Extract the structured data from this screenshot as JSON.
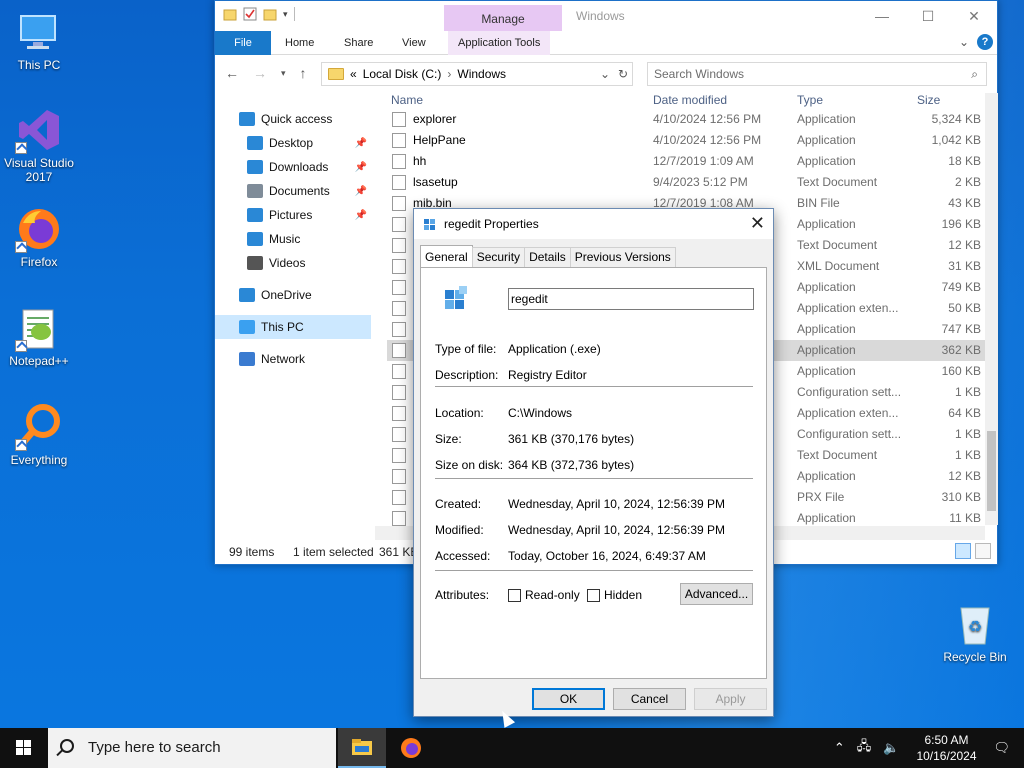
{
  "desktop": {
    "icons": [
      {
        "label": "This PC",
        "icon": "monitor-icon"
      },
      {
        "label": "Visual Studio 2017",
        "icon": "visual-studio-icon"
      },
      {
        "label": "Firefox",
        "icon": "firefox-icon"
      },
      {
        "label": "Notepad++",
        "icon": "notepadpp-icon"
      },
      {
        "label": "Everything",
        "icon": "everything-search-icon"
      },
      {
        "label": "Recycle Bin",
        "icon": "recycle-bin-icon"
      }
    ]
  },
  "explorer": {
    "title": "Windows",
    "manage_tab": "Manage",
    "ribbon_tabs": [
      "File",
      "Home",
      "Share",
      "View",
      "Application Tools"
    ],
    "address": {
      "prefix": "«",
      "path": [
        "Local Disk (C:)",
        "Windows"
      ]
    },
    "search_placeholder": "Search Windows",
    "nav": [
      {
        "label": "Quick access",
        "icon": "star-icon",
        "pinned": false
      },
      {
        "label": "Desktop",
        "icon": "desktop-folder-icon",
        "pinned": true
      },
      {
        "label": "Downloads",
        "icon": "downloads-icon",
        "pinned": true
      },
      {
        "label": "Documents",
        "icon": "documents-icon",
        "pinned": true
      },
      {
        "label": "Pictures",
        "icon": "pictures-icon",
        "pinned": true
      },
      {
        "label": "Music",
        "icon": "music-icon",
        "pinned": false
      },
      {
        "label": "Videos",
        "icon": "videos-icon",
        "pinned": false
      },
      {
        "label": "OneDrive",
        "icon": "cloud-icon",
        "pinned": false
      },
      {
        "label": "This PC",
        "icon": "this-pc-icon",
        "pinned": false
      },
      {
        "label": "Network",
        "icon": "network-icon",
        "pinned": false
      }
    ],
    "columns": {
      "name": "Name",
      "date": "Date modified",
      "type": "Type",
      "size": "Size"
    },
    "files": [
      {
        "name": "explorer",
        "date": "4/10/2024 12:56 PM",
        "type": "Application",
        "size": "5,324 KB"
      },
      {
        "name": "HelpPane",
        "date": "4/10/2024 12:56 PM",
        "type": "Application",
        "size": "1,042 KB"
      },
      {
        "name": "hh",
        "date": "12/7/2019 1:09 AM",
        "type": "Application",
        "size": "18 KB"
      },
      {
        "name": "lsasetup",
        "date": "9/4/2023 5:12 PM",
        "type": "Text Document",
        "size": "2 KB"
      },
      {
        "name": "mib.bin",
        "date": "12/7/2019 1:08 AM",
        "type": "BIN File",
        "size": "43 KB"
      },
      {
        "name": "",
        "date": "",
        "type": "Application",
        "size": "196 KB"
      },
      {
        "name": "",
        "date": "",
        "type": "Text Document",
        "size": "12 KB"
      },
      {
        "name": "",
        "date": "",
        "type": "XML Document",
        "size": "31 KB"
      },
      {
        "name": "",
        "date": "",
        "type": "Application",
        "size": "749 KB"
      },
      {
        "name": "",
        "date": "",
        "type": "Application exten...",
        "size": "50 KB"
      },
      {
        "name": "",
        "date": "",
        "type": "Application",
        "size": "747 KB"
      },
      {
        "name": "",
        "date": "",
        "type": "Application",
        "size": "362 KB"
      },
      {
        "name": "",
        "date": "",
        "type": "Application",
        "size": "160 KB"
      },
      {
        "name": "",
        "date": "",
        "type": "Configuration sett...",
        "size": "1 KB"
      },
      {
        "name": "",
        "date": "",
        "type": "Application exten...",
        "size": "64 KB"
      },
      {
        "name": "",
        "date": "",
        "type": "Configuration sett...",
        "size": "1 KB"
      },
      {
        "name": "",
        "date": "",
        "type": "Text Document",
        "size": "1 KB"
      },
      {
        "name": "",
        "date": "",
        "type": "Application",
        "size": "12 KB"
      },
      {
        "name": "",
        "date": "",
        "type": "PRX File",
        "size": "310 KB"
      },
      {
        "name": "",
        "date": "",
        "type": "Application",
        "size": "11 KB"
      }
    ],
    "selected_row": 11,
    "status": {
      "items": "99 items",
      "selected": "1 item selected",
      "size": "361 KB"
    }
  },
  "dialog": {
    "title": "regedit Properties",
    "tabs": [
      "General",
      "Security",
      "Details",
      "Previous Versions"
    ],
    "active_tab": "General",
    "name_value": "regedit",
    "fields": {
      "type_label": "Type of file:",
      "type_value": "Application (.exe)",
      "desc_label": "Description:",
      "desc_value": "Registry Editor",
      "loc_label": "Location:",
      "loc_value": "C:\\Windows",
      "size_label": "Size:",
      "size_value": "361 KB (370,176 bytes)",
      "disk_label": "Size on disk:",
      "disk_value": "364 KB (372,736 bytes)",
      "created_label": "Created:",
      "created_value": "Wednesday, April 10, 2024, 12:56:39 PM",
      "modified_label": "Modified:",
      "modified_value": "Wednesday, April 10, 2024, 12:56:39 PM",
      "accessed_label": "Accessed:",
      "accessed_value": "Today, October 16, 2024, 6:49:37 AM",
      "attr_label": "Attributes:",
      "readonly": "Read-only",
      "hidden": "Hidden"
    },
    "buttons": {
      "advanced": "Advanced...",
      "ok": "OK",
      "cancel": "Cancel",
      "apply": "Apply"
    }
  },
  "taskbar": {
    "search_placeholder": "Type here to search",
    "time": "6:50 AM",
    "date": "10/16/2024"
  }
}
